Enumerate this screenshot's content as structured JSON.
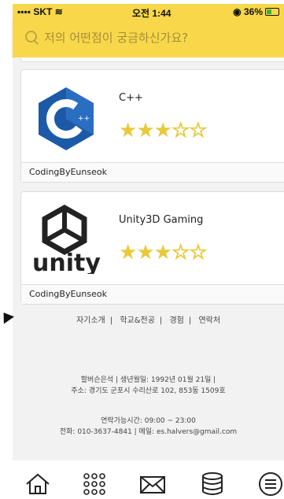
{
  "status": {
    "carrier": "SKT",
    "time": "오전 1:44",
    "battery": "36%"
  },
  "search": {
    "placeholder": "저의 어떤점이 궁금하신가요?"
  },
  "cards": [
    {
      "title": "C++",
      "author": "CodingByEunseok",
      "rating": 3,
      "max_rating": 5,
      "logo": "cpp-logo"
    },
    {
      "title": "Unity3D Gaming",
      "author": "CodingByEunseok",
      "rating": 3,
      "max_rating": 5,
      "logo": "unity-logo",
      "logo_text": "unity"
    }
  ],
  "footer": {
    "links": [
      "자기소개",
      "학교&전공",
      "경험",
      "연락처"
    ],
    "info_line1": "할버슨은석 | 생년월일: 1992년 01월 21일 |",
    "info_line2": "주소: 경기도 군포시 수리산로 102, 853동 1509호",
    "contact_line1": "연락가능시간: 09:00 ~ 23:00",
    "contact_line2": "전화: 010-3637-4841 | 메일: es.halvers@gmail.com"
  },
  "tabbar": {
    "icons": [
      "home-icon",
      "apps-grid-icon",
      "mail-icon",
      "database-icon",
      "menu-icon"
    ]
  },
  "colors": {
    "accent": "#f8d84a",
    "star": "#e8c93a",
    "cpp_blue": "#1c5aa8"
  }
}
